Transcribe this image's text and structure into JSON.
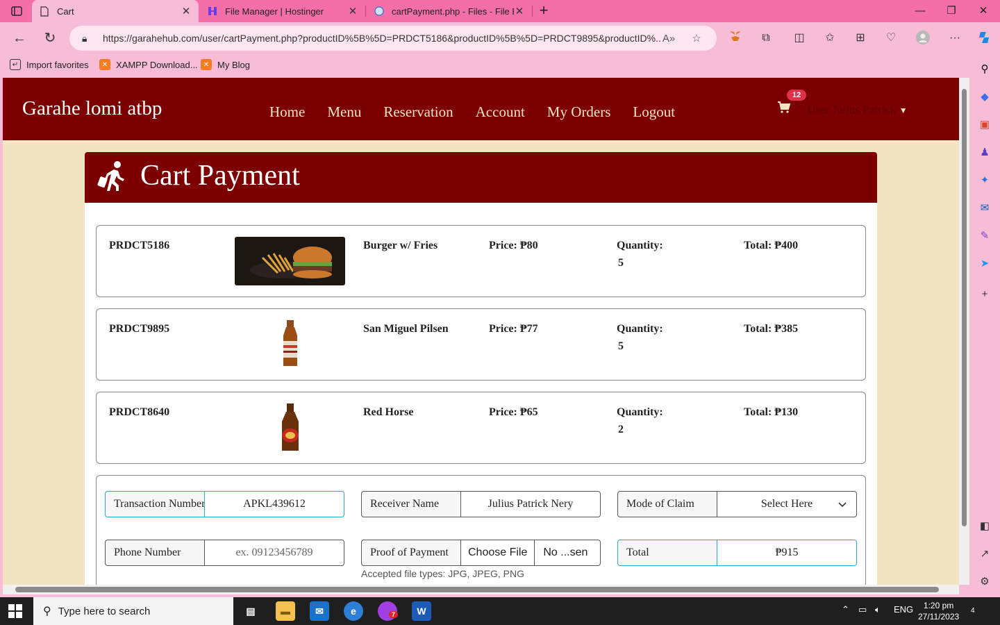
{
  "browser": {
    "tabs": [
      {
        "title": "Cart",
        "icon": "page-icon",
        "active": true
      },
      {
        "title": "File Manager | Hostinger",
        "icon": "hostinger-icon",
        "active": false
      },
      {
        "title": "cartPayment.php - Files - File Bro",
        "icon": "globe-icon",
        "active": false
      }
    ],
    "url": "https://garahehub.com/user/cartPayment.php?productID%5B%5D=PRDCT5186&productID%5B%5D=PRDCT9895&productID%...",
    "favorites": [
      {
        "label": "Import favorites",
        "icon": "import-icon"
      },
      {
        "label": "XAMPP Download...",
        "icon": "xampp-icon"
      },
      {
        "label": "My Blog",
        "icon": "xampp-icon"
      }
    ]
  },
  "site": {
    "brand": "Garahe lomi atbp",
    "nav": [
      "Home",
      "Menu",
      "Reservation",
      "Account",
      "My Orders",
      "Logout"
    ],
    "cart_count": "12",
    "user": "User Julius Patrick"
  },
  "page": {
    "title": "Cart Payment",
    "items": [
      {
        "id": "PRDCT5186",
        "name": "Burger w/ Fries",
        "price": "Price: ₱80",
        "qty_label": "Quantity:",
        "qty": "5",
        "total": "Total: ₱400",
        "image": "burger-fries-photo"
      },
      {
        "id": "PRDCT9895",
        "name": "San Miguel Pilsen",
        "price": "Price: ₱77",
        "qty_label": "Quantity:",
        "qty": "5",
        "total": "Total: ₱385",
        "image": "san-miguel-bottle"
      },
      {
        "id": "PRDCT8640",
        "name": "Red Horse",
        "price": "Price: ₱65",
        "qty_label": "Quantity:",
        "qty": "2",
        "total": "Total: ₱130",
        "image": "red-horse-bottle"
      }
    ],
    "form": {
      "transaction_label": "Transaction Number",
      "transaction_value": "APKL439612",
      "receiver_label": "Receiver Name",
      "receiver_value": "Julius Patrick  Nery",
      "claim_label": "Mode of Claim",
      "claim_value": "Select Here",
      "phone_label": "Phone Number",
      "phone_placeholder": "ex. 09123456789",
      "proof_label": "Proof of Payment",
      "file_button": "Choose File",
      "file_status": "No ...sen",
      "file_hint": "Accepted file types: JPG, JPEG, PNG",
      "total_label": "Total",
      "total_value": "₱915"
    }
  },
  "taskbar": {
    "search_placeholder": "Type here to search",
    "lang": "ENG",
    "time": "1:20 pm",
    "date": "27/11/2023",
    "notification_count": "4",
    "messenger_badge": "7"
  },
  "colors": {
    "brand_red": "#7d0000",
    "page_bg": "#f2e6c2",
    "chrome_pink": "#f7bcd6",
    "tabbar_pink": "#f46ea8",
    "badge_red": "#e0314b"
  }
}
